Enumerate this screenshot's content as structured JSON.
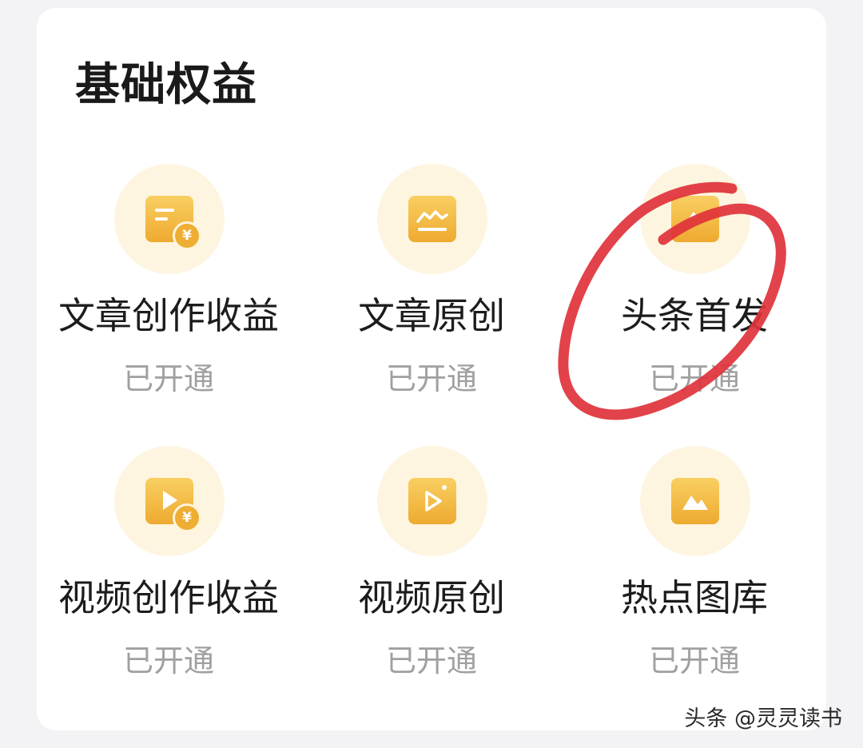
{
  "section": {
    "title": "基础权益"
  },
  "benefits": [
    {
      "label": "文章创作收益",
      "status": "已开通",
      "icon": "article-income-icon"
    },
    {
      "label": "文章原创",
      "status": "已开通",
      "icon": "article-original-icon"
    },
    {
      "label": "头条首发",
      "status": "已开通",
      "icon": "first-publish-icon"
    },
    {
      "label": "视频创作收益",
      "status": "已开通",
      "icon": "video-income-icon"
    },
    {
      "label": "视频原创",
      "status": "已开通",
      "icon": "video-original-icon"
    },
    {
      "label": "热点图库",
      "status": "已开通",
      "icon": "image-library-icon"
    }
  ],
  "coin_symbol": "¥",
  "watermark": "头条 @灵灵读书",
  "colors": {
    "accent": "#eeaa30",
    "icon_bg": "#fdf5df",
    "annotation": "#e0323a"
  }
}
